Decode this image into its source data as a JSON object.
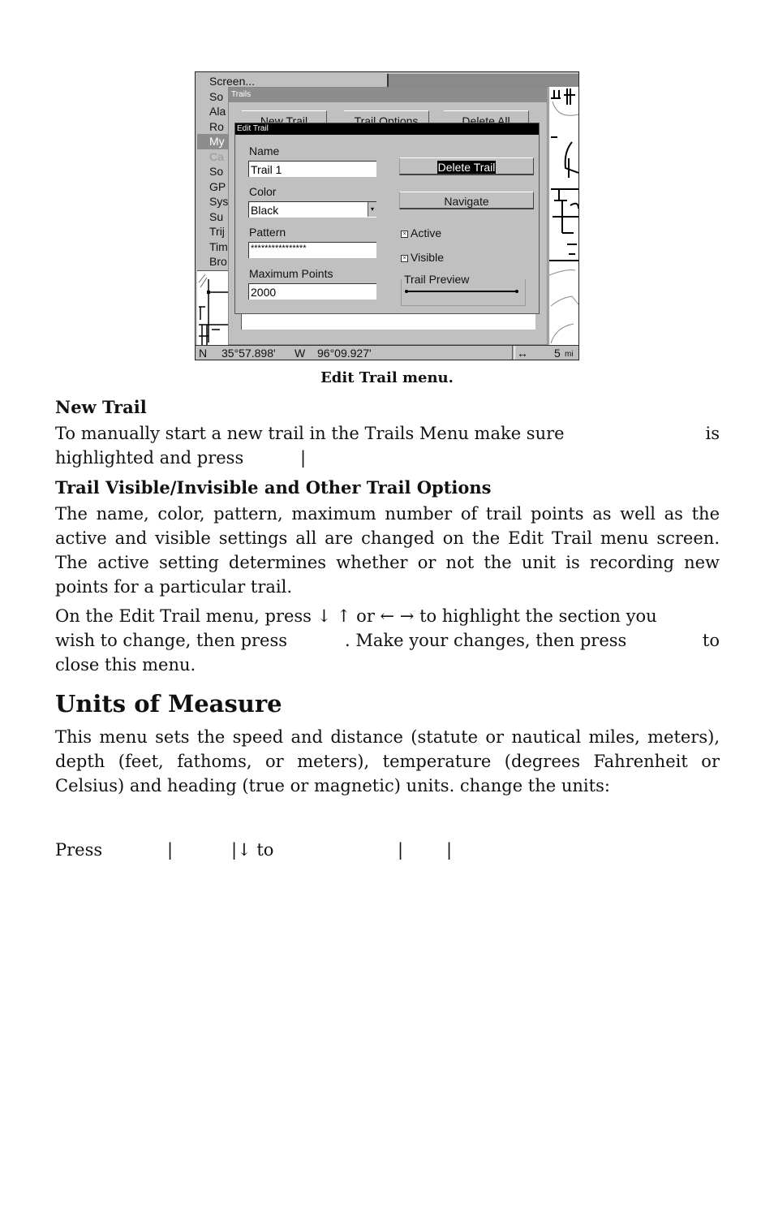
{
  "figure": {
    "menu_items": [
      {
        "label": "Screen...",
        "state": "normal"
      },
      {
        "label": "So",
        "state": "normal"
      },
      {
        "label": "Ala",
        "state": "normal"
      },
      {
        "label": "Ro",
        "state": "normal"
      },
      {
        "label": "My",
        "state": "highlighted"
      },
      {
        "label": "Ca",
        "state": "disabled"
      },
      {
        "label": "So",
        "state": "normal"
      },
      {
        "label": "GP",
        "state": "normal"
      },
      {
        "label": "Sys",
        "state": "normal"
      },
      {
        "label": "Su",
        "state": "normal"
      },
      {
        "label": "Trij",
        "state": "normal"
      },
      {
        "label": "Tim",
        "state": "normal"
      },
      {
        "label": "Bro",
        "state": "normal"
      }
    ],
    "trails_window": {
      "title": "Trails",
      "buttons": [
        "New Trail",
        "Trail Options",
        "Delete All"
      ]
    },
    "edit_trail": {
      "title": "Edit Trail",
      "name_label": "Name",
      "name_value": "Trail 1",
      "color_label": "Color",
      "color_value": "Black",
      "dropdown_arrow": "▾",
      "pattern_label": "Pattern",
      "pattern_value": "****************",
      "max_points_label": "Maximum Points",
      "max_points_value": "2000",
      "delete_button": "Delete Trail",
      "navigate_button": "Navigate",
      "active_label": "Active",
      "active_checked": true,
      "visible_label": "Visible",
      "visible_checked": true,
      "checkbox_mark": "×",
      "preview_label": "Trail Preview"
    },
    "statusbar": {
      "lat_hemi": "N",
      "lat": "35°57.898'",
      "lon_hemi": "W",
      "lon": "96°09.927'",
      "zoom_icon": "↔",
      "scale_value": "5",
      "scale_unit": "mi"
    },
    "caption": "Edit Trail menu."
  },
  "document": {
    "new_trail_heading": "New Trail",
    "new_trail_line1_a": "To manually start a new trail in the Trails Menu make sure",
    "new_trail_line1_b": "is",
    "new_trail_line2_a": "highlighted and press",
    "new_trail_line2_b": "|",
    "options_heading": "Trail Visible/Invisible and Other Trail Options",
    "options_para": "The name, color, pattern, maximum number of trail points as well as the active and visible settings all are changed on the Edit Trail menu screen. The active setting determines whether or not the unit is recording new points for a particular trail.",
    "edit_para_line1": "On the Edit Trail menu, press ↓ ↑ or ← → to highlight the section you",
    "edit_para_line2_a": "wish to change, then press",
    "edit_para_line2_b": ". Make your changes, then press",
    "edit_para_line2_c": "to",
    "edit_para_line3": "close this menu.",
    "units_heading": "Units of Measure",
    "units_para": "This menu sets the speed and distance (statute or nautical miles, meters), depth (feet, fathoms, or meters), temperature (degrees Fahrenheit or Celsius) and heading (true or magnetic) units. change the units:",
    "press_line": {
      "press": "Press",
      "sep1": "|",
      "sep2": "|↓ to",
      "sep3": "|",
      "sep4": "|"
    }
  }
}
